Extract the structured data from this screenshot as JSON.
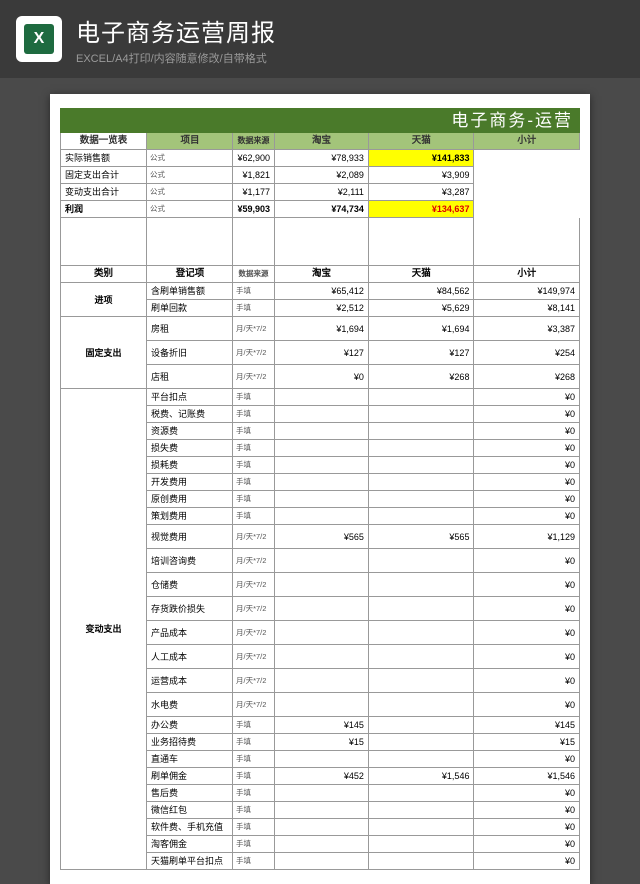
{
  "header": {
    "icon_letter": "X",
    "title": "电子商务运营周报",
    "subtitle": "EXCEL/A4打印/内容随意修改/自带格式"
  },
  "sheet_title": "电子商务-运营",
  "top_headers": {
    "c0": "项目",
    "c1": "数据来源",
    "c2": "淘宝",
    "c3": "天猫",
    "c4": "小计"
  },
  "top_label": "数据一览表",
  "top_rows": [
    {
      "item": "实际销售额",
      "src": "公式",
      "tb": "¥62,900",
      "tm": "¥78,933",
      "sub": "¥141,833",
      "hl": true
    },
    {
      "item": "固定支出合计",
      "src": "公式",
      "tb": "¥1,821",
      "tm": "¥2,089",
      "sub": "¥3,909"
    },
    {
      "item": "变动支出合计",
      "src": "公式",
      "tb": "¥1,177",
      "tm": "¥2,111",
      "sub": "¥3,287"
    },
    {
      "item": "利润",
      "src": "公式",
      "tb": "¥59,903",
      "tm": "¥74,734",
      "sub": "¥134,637",
      "hl": true,
      "bold": true,
      "red": true
    }
  ],
  "mid_headers": {
    "c0": "类别",
    "c1": "登记项",
    "c2": "数据来源",
    "c3": "淘宝",
    "c4": "天猫",
    "c5": "小计"
  },
  "sections": [
    {
      "label": "进项",
      "rows": [
        {
          "item": "含刷单销售额",
          "src": "手填",
          "tb": "¥65,412",
          "tm": "¥84,562",
          "sub": "¥149,974"
        },
        {
          "item": "刷单回款",
          "src": "手填",
          "tb": "¥2,512",
          "tm": "¥5,629",
          "sub": "¥8,141"
        }
      ]
    },
    {
      "label": "固定支出",
      "rows": [
        {
          "item": "房租",
          "src": "月/天*7/2",
          "tb": "¥1,694",
          "tm": "¥1,694",
          "sub": "¥3,387",
          "tall": true
        },
        {
          "item": "设备折旧",
          "src": "月/天*7/2",
          "tb": "¥127",
          "tm": "¥127",
          "sub": "¥254",
          "tall": true
        },
        {
          "item": "店租",
          "src": "月/天*7/2",
          "tb": "¥0",
          "tm": "¥268",
          "sub": "¥268",
          "tall": true
        }
      ]
    },
    {
      "label": "变动支出",
      "rows": [
        {
          "item": "平台扣点",
          "src": "手填",
          "tb": "",
          "tm": "",
          "sub": "¥0"
        },
        {
          "item": "税费、记账费",
          "src": "手填",
          "tb": "",
          "tm": "",
          "sub": "¥0"
        },
        {
          "item": "资源费",
          "src": "手填",
          "tb": "",
          "tm": "",
          "sub": "¥0"
        },
        {
          "item": "损失费",
          "src": "手填",
          "tb": "",
          "tm": "",
          "sub": "¥0"
        },
        {
          "item": "损耗费",
          "src": "手填",
          "tb": "",
          "tm": "",
          "sub": "¥0"
        },
        {
          "item": "开发费用",
          "src": "手填",
          "tb": "",
          "tm": "",
          "sub": "¥0"
        },
        {
          "item": "原创费用",
          "src": "手填",
          "tb": "",
          "tm": "",
          "sub": "¥0"
        },
        {
          "item": "策划费用",
          "src": "手填",
          "tb": "",
          "tm": "",
          "sub": "¥0"
        },
        {
          "item": "视觉费用",
          "src": "月/天*7/2",
          "tb": "¥565",
          "tm": "¥565",
          "sub": "¥1,129",
          "tall": true
        },
        {
          "item": "培训咨询费",
          "src": "月/天*7/2",
          "tb": "",
          "tm": "",
          "sub": "¥0",
          "tall": true
        },
        {
          "item": "仓储费",
          "src": "月/天*7/2",
          "tb": "",
          "tm": "",
          "sub": "¥0",
          "tall": true
        },
        {
          "item": "存货跌价损失",
          "src": "月/天*7/2",
          "tb": "",
          "tm": "",
          "sub": "¥0",
          "tall": true
        },
        {
          "item": "产品成本",
          "src": "月/天*7/2",
          "tb": "",
          "tm": "",
          "sub": "¥0",
          "tall": true
        },
        {
          "item": "人工成本",
          "src": "月/天*7/2",
          "tb": "",
          "tm": "",
          "sub": "¥0",
          "tall": true
        },
        {
          "item": "运营成本",
          "src": "月/天*7/2",
          "tb": "",
          "tm": "",
          "sub": "¥0",
          "tall": true
        },
        {
          "item": "水电费",
          "src": "月/天*7/2",
          "tb": "",
          "tm": "",
          "sub": "¥0",
          "tall": true
        },
        {
          "item": "办公费",
          "src": "手填",
          "tb": "¥145",
          "tm": "",
          "sub": "¥145"
        },
        {
          "item": "业务招待费",
          "src": "手填",
          "tb": "¥15",
          "tm": "",
          "sub": "¥15"
        },
        {
          "item": "直通车",
          "src": "手填",
          "tb": "",
          "tm": "",
          "sub": "¥0"
        },
        {
          "item": "刷单佣金",
          "src": "手填",
          "tb": "¥452",
          "tm": "¥1,546",
          "sub": "¥1,546"
        },
        {
          "item": "售后费",
          "src": "手填",
          "tb": "",
          "tm": "",
          "sub": "¥0"
        },
        {
          "item": "微信红包",
          "src": "手填",
          "tb": "",
          "tm": "",
          "sub": "¥0"
        },
        {
          "item": "软件费、手机充值",
          "src": "手填",
          "tb": "",
          "tm": "",
          "sub": "¥0"
        },
        {
          "item": "淘客佣金",
          "src": "手填",
          "tb": "",
          "tm": "",
          "sub": "¥0"
        },
        {
          "item": "天猫刷单平台扣点",
          "src": "手填",
          "tb": "",
          "tm": "",
          "sub": "¥0"
        }
      ]
    }
  ]
}
